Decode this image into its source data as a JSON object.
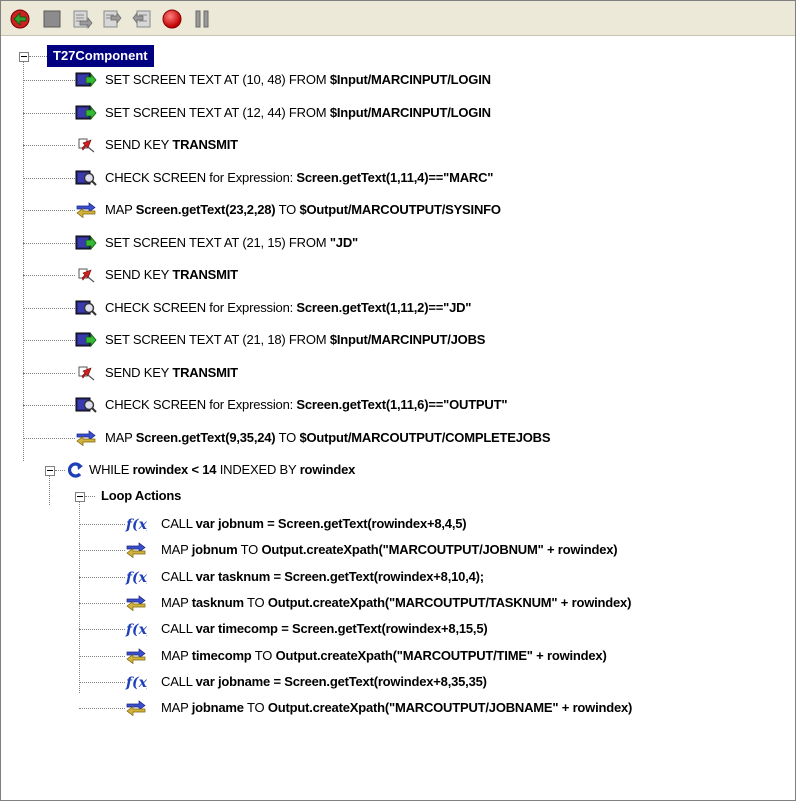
{
  "toolbar": {
    "buttons": [
      {
        "icon": "run-arrow-icon"
      },
      {
        "icon": "stop-square-icon"
      },
      {
        "icon": "step-over-icon"
      },
      {
        "icon": "step-into-icon"
      },
      {
        "icon": "step-out-icon"
      },
      {
        "icon": "breakpoint-icon"
      },
      {
        "icon": "pause-icon"
      }
    ]
  },
  "tree": {
    "root": "T27Component",
    "actions": [
      {
        "icon": "set-screen-text-icon",
        "parts": [
          [
            "SET SCREEN TEXT AT (10, 48) FROM ",
            false
          ],
          [
            "$Input/MARCINPUT/LOGIN",
            true
          ]
        ]
      },
      {
        "icon": "set-screen-text-icon",
        "parts": [
          [
            "SET SCREEN TEXT AT (12, 44) FROM ",
            false
          ],
          [
            "$Input/MARCINPUT/LOGIN",
            true
          ]
        ]
      },
      {
        "icon": "send-key-icon",
        "parts": [
          [
            "SEND KEY ",
            false
          ],
          [
            "TRANSMIT",
            true
          ]
        ]
      },
      {
        "icon": "check-screen-icon",
        "parts": [
          [
            "CHECK SCREEN for Expression: ",
            false
          ],
          [
            "Screen.getText(1,11,4)==\"MARC\"",
            true
          ]
        ]
      },
      {
        "icon": "map-icon",
        "parts": [
          [
            "MAP ",
            false
          ],
          [
            "Screen.getText(23,2,28)",
            true
          ],
          [
            " TO ",
            false
          ],
          [
            "$Output/MARCOUTPUT/SYSINFO",
            true
          ]
        ]
      },
      {
        "icon": "set-screen-text-icon",
        "parts": [
          [
            "SET SCREEN TEXT AT (21, 15) FROM ",
            false
          ],
          [
            "\"JD\"",
            true
          ]
        ]
      },
      {
        "icon": "send-key-icon",
        "parts": [
          [
            "SEND KEY ",
            false
          ],
          [
            "TRANSMIT",
            true
          ]
        ]
      },
      {
        "icon": "check-screen-icon",
        "parts": [
          [
            "CHECK SCREEN for Expression: ",
            false
          ],
          [
            "Screen.getText(1,11,2)==\"JD\"",
            true
          ]
        ]
      },
      {
        "icon": "set-screen-text-icon",
        "parts": [
          [
            "SET SCREEN TEXT AT (21, 18) FROM ",
            false
          ],
          [
            "$Input/MARCINPUT/JOBS",
            true
          ]
        ]
      },
      {
        "icon": "send-key-icon",
        "parts": [
          [
            "SEND KEY ",
            false
          ],
          [
            "TRANSMIT",
            true
          ]
        ]
      },
      {
        "icon": "check-screen-icon",
        "parts": [
          [
            "CHECK SCREEN for Expression: ",
            false
          ],
          [
            "Screen.getText(1,11,6)==\"OUTPUT\"",
            true
          ]
        ]
      },
      {
        "icon": "map-icon",
        "parts": [
          [
            "MAP ",
            false
          ],
          [
            "Screen.getText(9,35,24)",
            true
          ],
          [
            " TO ",
            false
          ],
          [
            "$Output/MARCOUTPUT/COMPLETEJOBS",
            true
          ]
        ]
      }
    ],
    "while": {
      "icon": "loop-icon",
      "parts": [
        [
          "WHILE ",
          false
        ],
        [
          "rowindex < 14",
          true
        ],
        [
          " INDEXED BY ",
          false
        ],
        [
          "rowindex",
          true
        ]
      ]
    },
    "loop_label": "Loop Actions",
    "loop_actions": [
      {
        "icon": "function-icon",
        "parts": [
          [
            "CALL ",
            false
          ],
          [
            "var jobnum = Screen.getText(rowindex+8,4,5)",
            true
          ]
        ]
      },
      {
        "icon": "map-icon",
        "parts": [
          [
            "MAP ",
            false
          ],
          [
            "jobnum",
            true
          ],
          [
            " TO ",
            false
          ],
          [
            "Output.createXpath(\"MARCOUTPUT/JOBNUM\" + rowindex)",
            true
          ]
        ]
      },
      {
        "icon": "function-icon",
        "parts": [
          [
            "CALL ",
            false
          ],
          [
            "var tasknum = Screen.getText(rowindex+8,10,4);",
            true
          ]
        ]
      },
      {
        "icon": "map-icon",
        "parts": [
          [
            "MAP ",
            false
          ],
          [
            "tasknum",
            true
          ],
          [
            " TO ",
            false
          ],
          [
            "Output.createXpath(\"MARCOUTPUT/TASKNUM\" + rowindex)",
            true
          ]
        ]
      },
      {
        "icon": "function-icon",
        "parts": [
          [
            "CALL ",
            false
          ],
          [
            "var timecomp = Screen.getText(rowindex+8,15,5)",
            true
          ]
        ]
      },
      {
        "icon": "map-icon",
        "parts": [
          [
            "MAP ",
            false
          ],
          [
            "timecomp",
            true
          ],
          [
            " TO ",
            false
          ],
          [
            "Output.createXpath(\"MARCOUTPUT/TIME\" + rowindex)",
            true
          ]
        ]
      },
      {
        "icon": "function-icon",
        "parts": [
          [
            "CALL ",
            false
          ],
          [
            "var jobname = Screen.getText(rowindex+8,35,35)",
            true
          ]
        ]
      },
      {
        "icon": "map-icon",
        "parts": [
          [
            "MAP ",
            false
          ],
          [
            "jobname",
            true
          ],
          [
            " TO ",
            false
          ],
          [
            "Output.createXpath(\"MARCOUTPUT/JOBNAME\" + rowindex)",
            true
          ]
        ]
      }
    ]
  }
}
